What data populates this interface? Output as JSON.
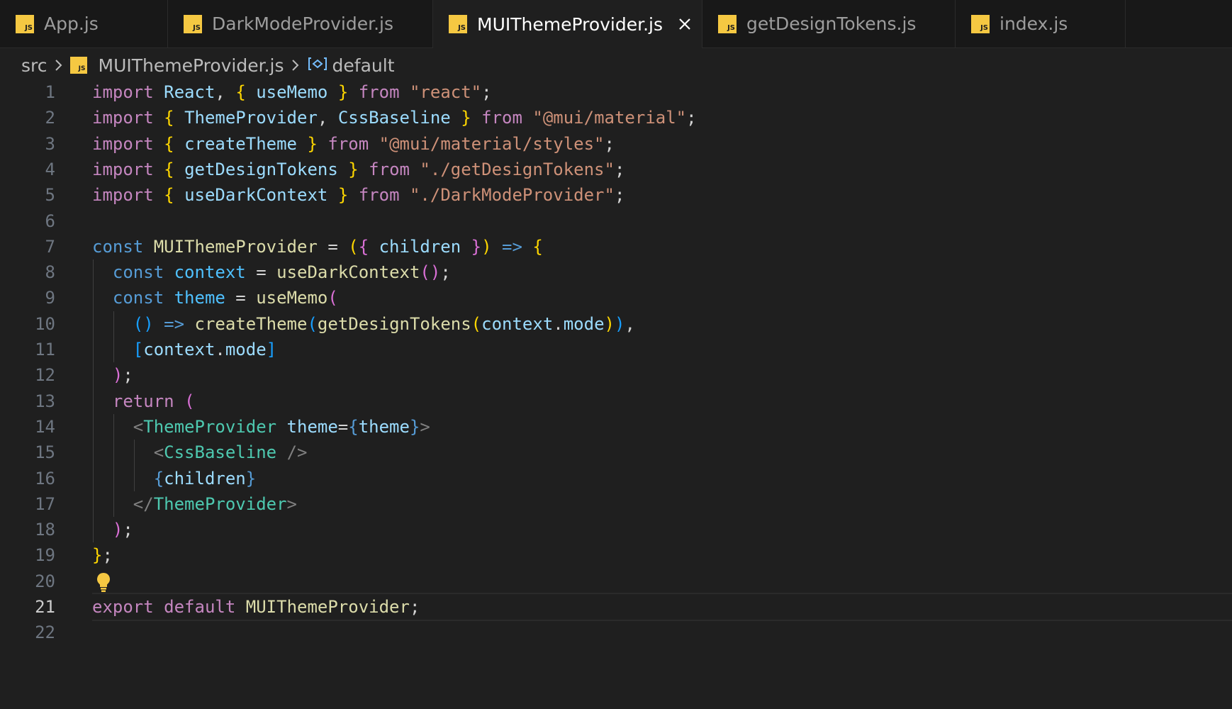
{
  "tabs": [
    {
      "label": "App.js",
      "icon": "js-file-icon",
      "active": false
    },
    {
      "label": "DarkModeProvider.js",
      "icon": "js-file-icon",
      "active": false
    },
    {
      "label": "MUIThemeProvider.js",
      "icon": "js-file-icon",
      "active": true
    },
    {
      "label": "getDesignTokens.js",
      "icon": "js-file-icon",
      "active": false
    },
    {
      "label": "index.js",
      "icon": "js-file-icon",
      "active": false
    }
  ],
  "js_icon_text": "JS",
  "breadcrumb": {
    "folder": "src",
    "file": "MUIThemeProvider.js",
    "symbol": "default"
  },
  "editor": {
    "current_line": 21,
    "line_numbers": [
      "1",
      "2",
      "3",
      "4",
      "5",
      "6",
      "7",
      "8",
      "9",
      "10",
      "11",
      "12",
      "13",
      "14",
      "15",
      "16",
      "17",
      "18",
      "19",
      "20",
      "21",
      "22"
    ],
    "lines": [
      [
        [
          "kw",
          "import"
        ],
        [
          "pun",
          " "
        ],
        [
          "va",
          "React"
        ],
        [
          "pun",
          ", "
        ],
        [
          "br1",
          "{"
        ],
        [
          "pun",
          " "
        ],
        [
          "va",
          "useMemo"
        ],
        [
          "pun",
          " "
        ],
        [
          "br1",
          "}"
        ],
        [
          "pun",
          " "
        ],
        [
          "kw",
          "from"
        ],
        [
          "pun",
          " "
        ],
        [
          "str",
          "\"react\""
        ],
        [
          "pun",
          ";"
        ]
      ],
      [
        [
          "kw",
          "import"
        ],
        [
          "pun",
          " "
        ],
        [
          "br1",
          "{"
        ],
        [
          "pun",
          " "
        ],
        [
          "va",
          "ThemeProvider"
        ],
        [
          "pun",
          ", "
        ],
        [
          "va",
          "CssBaseline"
        ],
        [
          "pun",
          " "
        ],
        [
          "br1",
          "}"
        ],
        [
          "pun",
          " "
        ],
        [
          "kw",
          "from"
        ],
        [
          "pun",
          " "
        ],
        [
          "str",
          "\"@mui/material\""
        ],
        [
          "pun",
          ";"
        ]
      ],
      [
        [
          "kw",
          "import"
        ],
        [
          "pun",
          " "
        ],
        [
          "br1",
          "{"
        ],
        [
          "pun",
          " "
        ],
        [
          "va",
          "createTheme"
        ],
        [
          "pun",
          " "
        ],
        [
          "br1",
          "}"
        ],
        [
          "pun",
          " "
        ],
        [
          "kw",
          "from"
        ],
        [
          "pun",
          " "
        ],
        [
          "str",
          "\"@mui/material/styles\""
        ],
        [
          "pun",
          ";"
        ]
      ],
      [
        [
          "kw",
          "import"
        ],
        [
          "pun",
          " "
        ],
        [
          "br1",
          "{"
        ],
        [
          "pun",
          " "
        ],
        [
          "va",
          "getDesignTokens"
        ],
        [
          "pun",
          " "
        ],
        [
          "br1",
          "}"
        ],
        [
          "pun",
          " "
        ],
        [
          "kw",
          "from"
        ],
        [
          "pun",
          " "
        ],
        [
          "str",
          "\"./getDesignTokens\""
        ],
        [
          "pun",
          ";"
        ]
      ],
      [
        [
          "kw",
          "import"
        ],
        [
          "pun",
          " "
        ],
        [
          "br1",
          "{"
        ],
        [
          "pun",
          " "
        ],
        [
          "va",
          "useDarkContext"
        ],
        [
          "pun",
          " "
        ],
        [
          "br1",
          "}"
        ],
        [
          "pun",
          " "
        ],
        [
          "kw",
          "from"
        ],
        [
          "pun",
          " "
        ],
        [
          "str",
          "\"./DarkModeProvider\""
        ],
        [
          "pun",
          ";"
        ]
      ],
      [],
      [
        [
          "st",
          "const"
        ],
        [
          "pun",
          " "
        ],
        [
          "fn",
          "MUIThemeProvider"
        ],
        [
          "pun",
          " = "
        ],
        [
          "br1",
          "("
        ],
        [
          "br2",
          "{"
        ],
        [
          "pun",
          " "
        ],
        [
          "va",
          "children"
        ],
        [
          "pun",
          " "
        ],
        [
          "br2",
          "}"
        ],
        [
          "br1",
          ")"
        ],
        [
          "pun",
          " "
        ],
        [
          "st",
          "=>"
        ],
        [
          "pun",
          " "
        ],
        [
          "br1",
          "{"
        ]
      ],
      [
        [
          "pun",
          "  "
        ],
        [
          "st",
          "const"
        ],
        [
          "pun",
          " "
        ],
        [
          "cn",
          "context"
        ],
        [
          "pun",
          " = "
        ],
        [
          "fn",
          "useDarkContext"
        ],
        [
          "br2",
          "()"
        ],
        [
          "pun",
          ";"
        ]
      ],
      [
        [
          "pun",
          "  "
        ],
        [
          "st",
          "const"
        ],
        [
          "pun",
          " "
        ],
        [
          "cn",
          "theme"
        ],
        [
          "pun",
          " = "
        ],
        [
          "fn",
          "useMemo"
        ],
        [
          "br2",
          "("
        ]
      ],
      [
        [
          "pun",
          "    "
        ],
        [
          "br3",
          "()"
        ],
        [
          "pun",
          " "
        ],
        [
          "st",
          "=>"
        ],
        [
          "pun",
          " "
        ],
        [
          "fn",
          "createTheme"
        ],
        [
          "br3",
          "("
        ],
        [
          "fn",
          "getDesignTokens"
        ],
        [
          "br1",
          "("
        ],
        [
          "va",
          "context"
        ],
        [
          "pun",
          "."
        ],
        [
          "va",
          "mode"
        ],
        [
          "br1",
          ")"
        ],
        [
          "br3",
          ")"
        ],
        [
          "pun",
          ","
        ]
      ],
      [
        [
          "pun",
          "    "
        ],
        [
          "br3",
          "["
        ],
        [
          "va",
          "context"
        ],
        [
          "pun",
          "."
        ],
        [
          "va",
          "mode"
        ],
        [
          "br3",
          "]"
        ]
      ],
      [
        [
          "pun",
          "  "
        ],
        [
          "br2",
          ")"
        ],
        [
          "pun",
          ";"
        ]
      ],
      [
        [
          "pun",
          "  "
        ],
        [
          "kw",
          "return"
        ],
        [
          "pun",
          " "
        ],
        [
          "br2",
          "("
        ]
      ],
      [
        [
          "pun",
          "    "
        ],
        [
          "tgp",
          "<"
        ],
        [
          "tag",
          "ThemeProvider"
        ],
        [
          "pun",
          " "
        ],
        [
          "va",
          "theme"
        ],
        [
          "pun",
          "="
        ],
        [
          "st",
          "{"
        ],
        [
          "va",
          "theme"
        ],
        [
          "st",
          "}"
        ],
        [
          "tgp",
          ">"
        ]
      ],
      [
        [
          "pun",
          "      "
        ],
        [
          "tgp",
          "<"
        ],
        [
          "tag",
          "CssBaseline"
        ],
        [
          "pun",
          " "
        ],
        [
          "tgp",
          "/>"
        ]
      ],
      [
        [
          "pun",
          "      "
        ],
        [
          "st",
          "{"
        ],
        [
          "va",
          "children"
        ],
        [
          "st",
          "}"
        ]
      ],
      [
        [
          "pun",
          "    "
        ],
        [
          "tgp",
          "</"
        ],
        [
          "tag",
          "ThemeProvider"
        ],
        [
          "tgp",
          ">"
        ]
      ],
      [
        [
          "pun",
          "  "
        ],
        [
          "br2",
          ")"
        ],
        [
          "pun",
          ";"
        ]
      ],
      [
        [
          "br1",
          "}"
        ],
        [
          "pun",
          ";"
        ]
      ],
      [],
      [
        [
          "kw",
          "export"
        ],
        [
          "pun",
          " "
        ],
        [
          "kw",
          "default"
        ],
        [
          "pun",
          " "
        ],
        [
          "fn",
          "MUIThemeProvider"
        ],
        [
          "pun",
          ";"
        ]
      ],
      []
    ]
  }
}
